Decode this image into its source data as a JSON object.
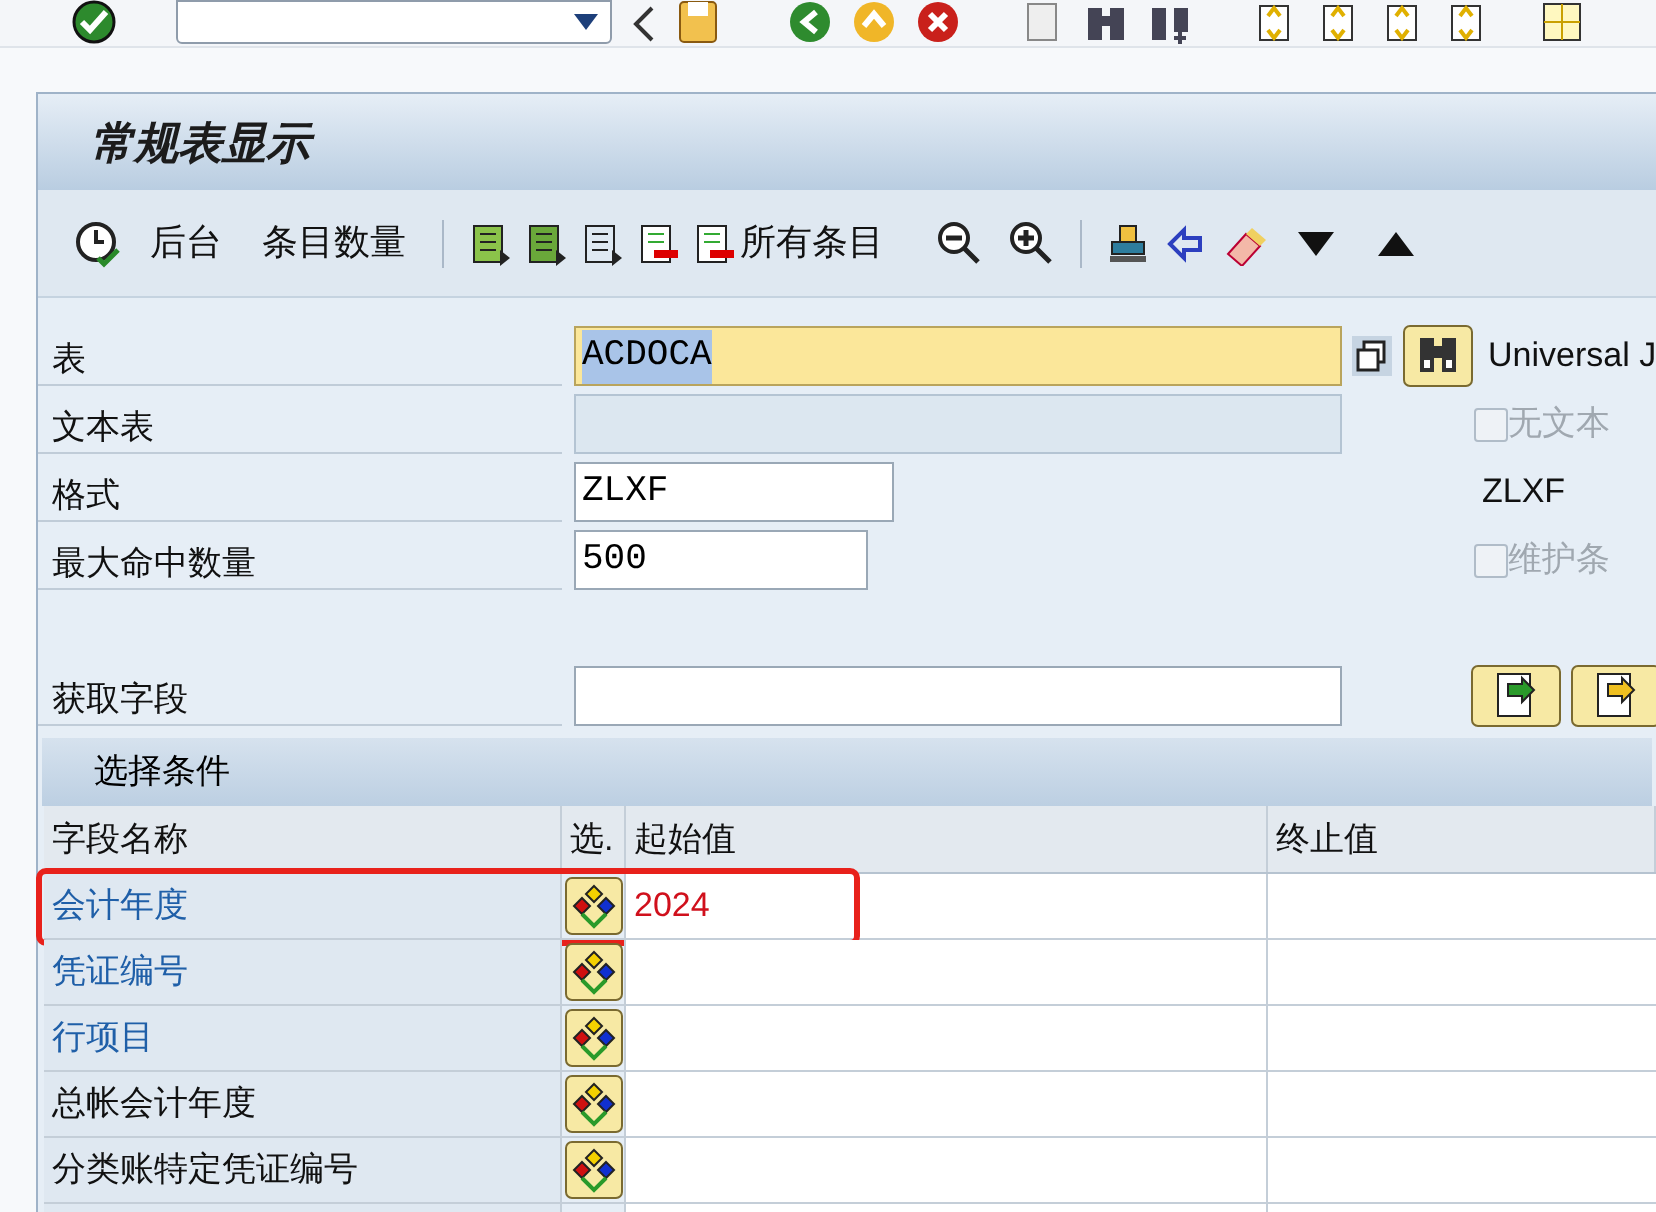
{
  "title": "常规表显示",
  "toolbar": [
    {
      "kind": "icon_text",
      "label": "后台"
    },
    {
      "kind": "text",
      "label": "条目数量"
    },
    {
      "kind": "icon_text",
      "label": "所有条目"
    }
  ],
  "form": [
    {
      "label": "表",
      "kind": "required",
      "value": "ACDOCA",
      "value_selected": true,
      "side": {
        "kind": "text",
        "text": "Universal J"
      }
    },
    {
      "label": "文本表",
      "kind": "disabled",
      "side": {
        "kind": "checkbox",
        "text": "无文本",
        "checked": false,
        "disabled": true
      }
    },
    {
      "label": "格式",
      "kind": "normal",
      "value": "ZLXF",
      "side": {
        "kind": "text",
        "text": "ZLXF"
      }
    },
    {
      "label": "最大命中数量",
      "kind": "normal",
      "value": "500",
      "side": {
        "kind": "checkbox",
        "text": "维护条",
        "checked": false,
        "disabled": true
      }
    },
    {
      "kind": "spacer"
    },
    {
      "label": "获取字段",
      "kind": "normal",
      "side": {
        "kind": "buttons"
      }
    }
  ],
  "selection": {
    "title": "选择条件",
    "columns": [
      "字段名称",
      "选.",
      "起始值",
      "终止值"
    ],
    "rows": [
      {
        "field": "会计年度",
        "key": true,
        "from": "2024",
        "highlighted": true
      },
      {
        "field": "凭证编号",
        "key": true,
        "highlighted": false
      },
      {
        "field": "行项目",
        "key": true,
        "highlighted": false
      },
      {
        "field": "总帐会计年度",
        "key": false,
        "highlighted": false
      },
      {
        "field": "分类账特定凭证编号",
        "key": false,
        "highlighted": false
      }
    ]
  }
}
